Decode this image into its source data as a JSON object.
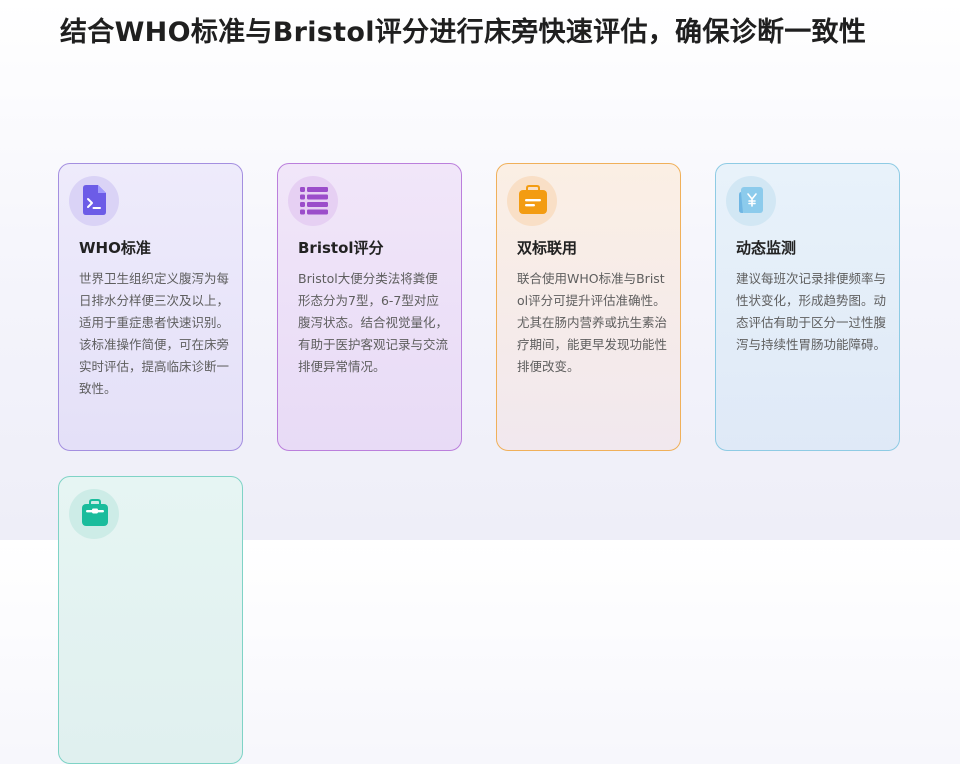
{
  "slide": {
    "title": "结合WHO标准与Bristol评分进行床旁快速评估，确保诊断一致性"
  },
  "cards": [
    {
      "title": "WHO标准",
      "body": "世界卫生组织定义腹泻为每日排水分样便三次及以上，适用于重症患者快速识别。该标准操作简便，可在床旁实时评估，提高临床诊断一致性。",
      "icon": "terminal-file-icon",
      "color": "#6c5ce7"
    },
    {
      "title": "Bristol评分",
      "body": "Bristol大便分类法将粪便形态分为7型，6-7型对应腹泻状态。结合视觉量化，有助于医护客观记录与交流排便异常情况。",
      "icon": "list-icon",
      "color": "#9b4dca"
    },
    {
      "title": "双标联用",
      "body": "联合使用WHO标准与Bristol评分可提升评估准确性。尤其在肠内营养或抗生素治疗期间，能更早发现功能性排便改变。",
      "icon": "wallet-icon",
      "color": "#f39c12"
    },
    {
      "title": "动态监测",
      "body": "建议每班次记录排便频率与性状变化，形成趋势图。动态评估有助于区分一过性腹泻与持续性胃肠功能障碍。",
      "icon": "yen-bill-icon",
      "color": "#6fb6e3"
    },
    {
      "title": "",
      "body": "",
      "icon": "toolbox-icon",
      "color": "#1abc9c"
    }
  ]
}
